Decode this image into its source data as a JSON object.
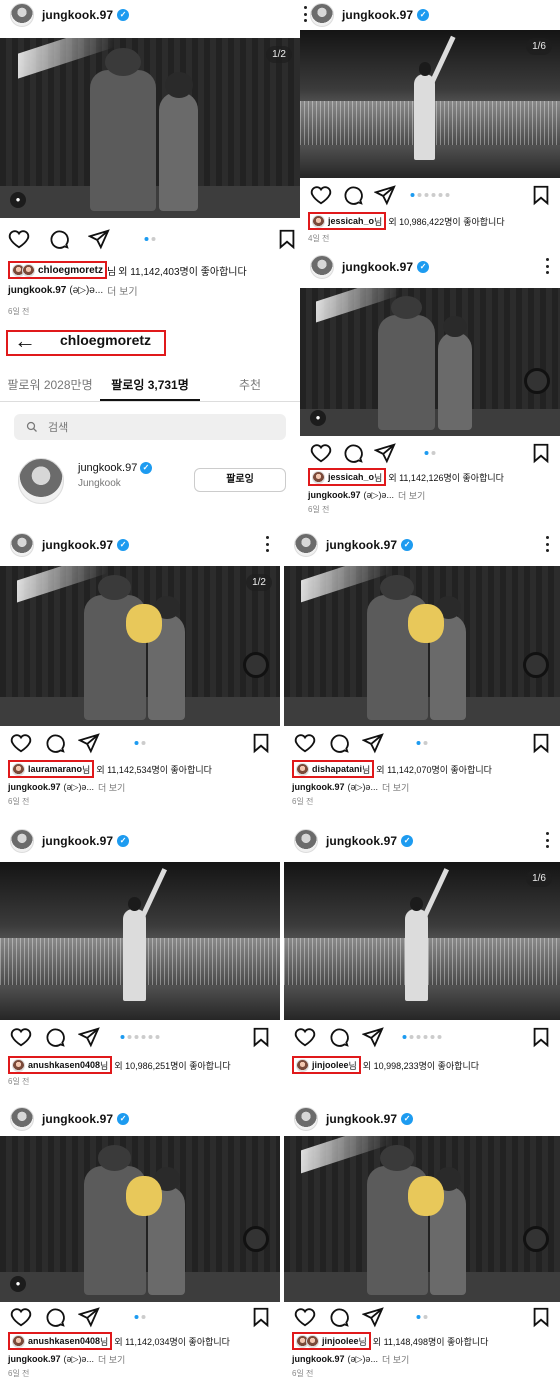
{
  "common": {
    "username": "jungkook.97",
    "verified_icon": "✓",
    "caption_user": "jungkook.97",
    "caption_text": "(ə▷)ə...",
    "more_label": "더 보기",
    "icons": [
      "heart-icon",
      "comment-icon",
      "share-icon",
      "bookmark-icon",
      "more-vertical-icon",
      "user-tag-icon"
    ]
  },
  "posts": {
    "p1": {
      "counter": "1/2",
      "liker": "chloegmoretz",
      "suffix": "님",
      "likes_text": "외 11,142,403명이 좋아합니다",
      "ago": "6일 전"
    },
    "p2": {
      "counter": "1/6",
      "liker": "jessicah_o",
      "suffix": "님",
      "likes_text": "외 10,986,422명이 좋아합니다",
      "ago": "4일 전"
    },
    "p3": {
      "liker": "jessicah_o",
      "suffix": "님",
      "likes_text": "외 11,142,126명이 좋아합니다",
      "ago": "6일 전"
    },
    "p4": {
      "counter": "1/2",
      "liker": "lauramarano",
      "suffix": "님",
      "likes_text": "외 11,142,534명이 좋아합니다",
      "ago": "6일 전"
    },
    "p5": {
      "liker": "dishapatani",
      "suffix": "님",
      "likes_text": "외 11,142,070명이 좋아합니다",
      "ago": "6일 전"
    },
    "p6": {
      "liker": "anushkasen0408",
      "suffix": "님",
      "likes_text": "외 10,986,251명이 좋아합니다",
      "ago": "6일 전"
    },
    "p7": {
      "counter": "1/6",
      "liker": "jinjoolee",
      "suffix": "님",
      "likes_text": "외 10,998,233명이 좋아합니다"
    },
    "p8": {
      "liker": "anushkasen0408",
      "suffix": "님",
      "likes_text": "외 11,142,034명이 좋아합니다",
      "ago": "6일 전"
    },
    "p9": {
      "liker": "jinjoolee",
      "suffix": "님",
      "likes_text": "외 11,148,498명이 좋아합니다",
      "ago": "6일 전"
    }
  },
  "following": {
    "back_icon": "←",
    "title": "chloegmoretz",
    "tabs": [
      "팔로워 2028만명",
      "팔로잉 3,731명",
      "추천"
    ],
    "search_placeholder": "검색",
    "user": {
      "username": "jungkook.97",
      "name": "Jungkook",
      "button": "팔로잉"
    }
  },
  "colors": {
    "highlight": "#e0191b",
    "verified": "#1d9bf0",
    "active_dot": "#1d9bf0"
  }
}
